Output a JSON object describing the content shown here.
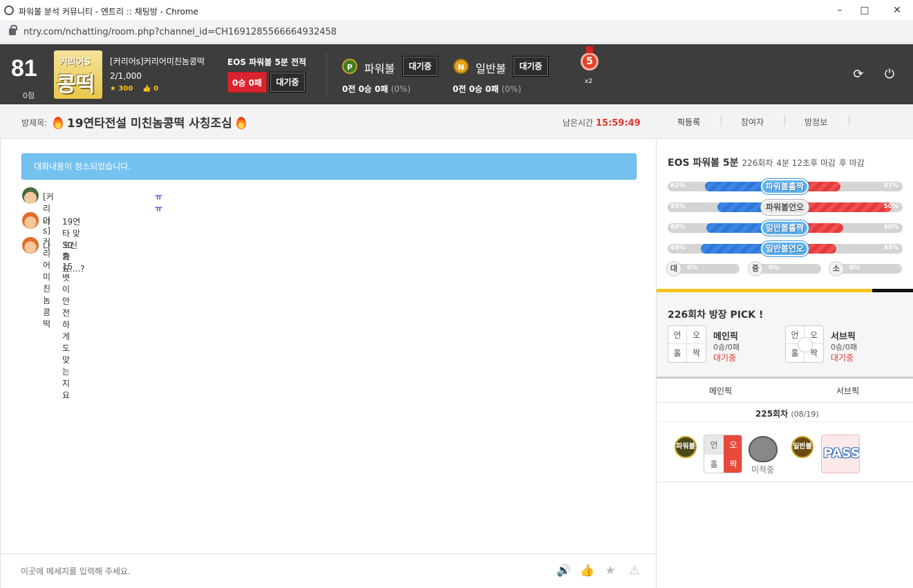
{
  "window": {
    "title": "파워볼 분석 커뮤니티 - 엔트리 :: 채팅방 - Chrome",
    "url": "ntry.com/nchatting/room.php?channel_id=CH1691285566664932458"
  },
  "topbar": {
    "score": "81",
    "score_label": "0점",
    "avatar_text_top": "커리어S",
    "avatar_text_main": "콩떡",
    "nickname": "[커리어s]커리어미친놈콩떡",
    "ranking": "2/1,000",
    "stars": "300",
    "likes": "0",
    "eos_label": "EOS 파워볼 5분 전적",
    "eos_record": "0승 0패",
    "eos_status": "대기중",
    "powerball": {
      "icon": "P",
      "title": "파워볼",
      "status": "대기중",
      "record_prefix": "0전",
      "record_main": "0승 0패",
      "pct": "(0%)"
    },
    "normalball": {
      "icon": "N",
      "title": "일반볼",
      "status": "대기중",
      "record_prefix": "0전",
      "record_main": "0승 0패",
      "pct": "(0%)"
    },
    "medal": "5",
    "multiplier": "x2"
  },
  "roombar": {
    "label": "방제목:",
    "title": "19연타전설 미친놈콩떡 사칭조심",
    "remain_label": "남은시간",
    "remain_time": "15:59:49",
    "tabs": [
      "픽등록",
      "참여자",
      "방정보"
    ]
  },
  "chat": {
    "notice": "대화내용이 청소되었습니다.",
    "messages": [
      {
        "name": "[커리어s]커리어미친놈콩떡",
        "text": "ㅠㅠ"
      },
      {
        "name": "나",
        "text": "19연타 맞으신가요....?"
      },
      {
        "name": "나",
        "text": "30출 15뱃이 안전하게도 맞는지요"
      }
    ],
    "input_placeholder": "이곳에 메세지를 입력해 주세요."
  },
  "side": {
    "game_title": "EOS 파워볼 5분",
    "round": "226회차",
    "countdown": "4분 12초후 마감",
    "countdown_suffix": "후 마감",
    "bars": [
      {
        "label": "파워볼홀짝",
        "left": "62%",
        "right": "37%",
        "left_val": 62,
        "right_val": 37
      },
      {
        "label": "파워볼언오",
        "left": "50%",
        "right": "50%",
        "left_val": 50,
        "right_val": 50
      },
      {
        "label": "일반볼홀짝",
        "left": "60%",
        "right": "40%",
        "left_val": 60,
        "right_val": 40
      },
      {
        "label": "일반볼언오",
        "left": "66%",
        "right": "33%",
        "left_val": 66,
        "right_val": 33
      }
    ],
    "size_bars": [
      {
        "label": "대",
        "value": "0%"
      },
      {
        "label": "중",
        "value": "0%"
      },
      {
        "label": "소",
        "value": "0%"
      }
    ],
    "pick_title": "226회차 방장 PICK !",
    "main_pick": {
      "name": "메인픽",
      "record": "0승/0패",
      "status": "대기중",
      "cells": [
        "언",
        "오",
        "홀",
        "짝"
      ]
    },
    "sub_pick": {
      "name": "서브픽",
      "record": "0승/0패",
      "status": "대기중",
      "cells": [
        "언",
        "오",
        "홀",
        "짝"
      ]
    },
    "history_tabs": [
      "메인픽",
      "서브픽"
    ],
    "history_round": "225회차",
    "history_date": "(08/19)",
    "history_main_badge": "파워볼",
    "history_main_cells": [
      "언",
      "오",
      "홀",
      "짝"
    ],
    "history_unhit": "미적중",
    "history_sub_badge": "일반볼",
    "history_pass": "PASS"
  },
  "colors": {
    "accent_red": "#d9232e",
    "accent_blue": "#74c2f0",
    "dark_bar": "#3d3d3d",
    "yellow": "#f5c518"
  }
}
